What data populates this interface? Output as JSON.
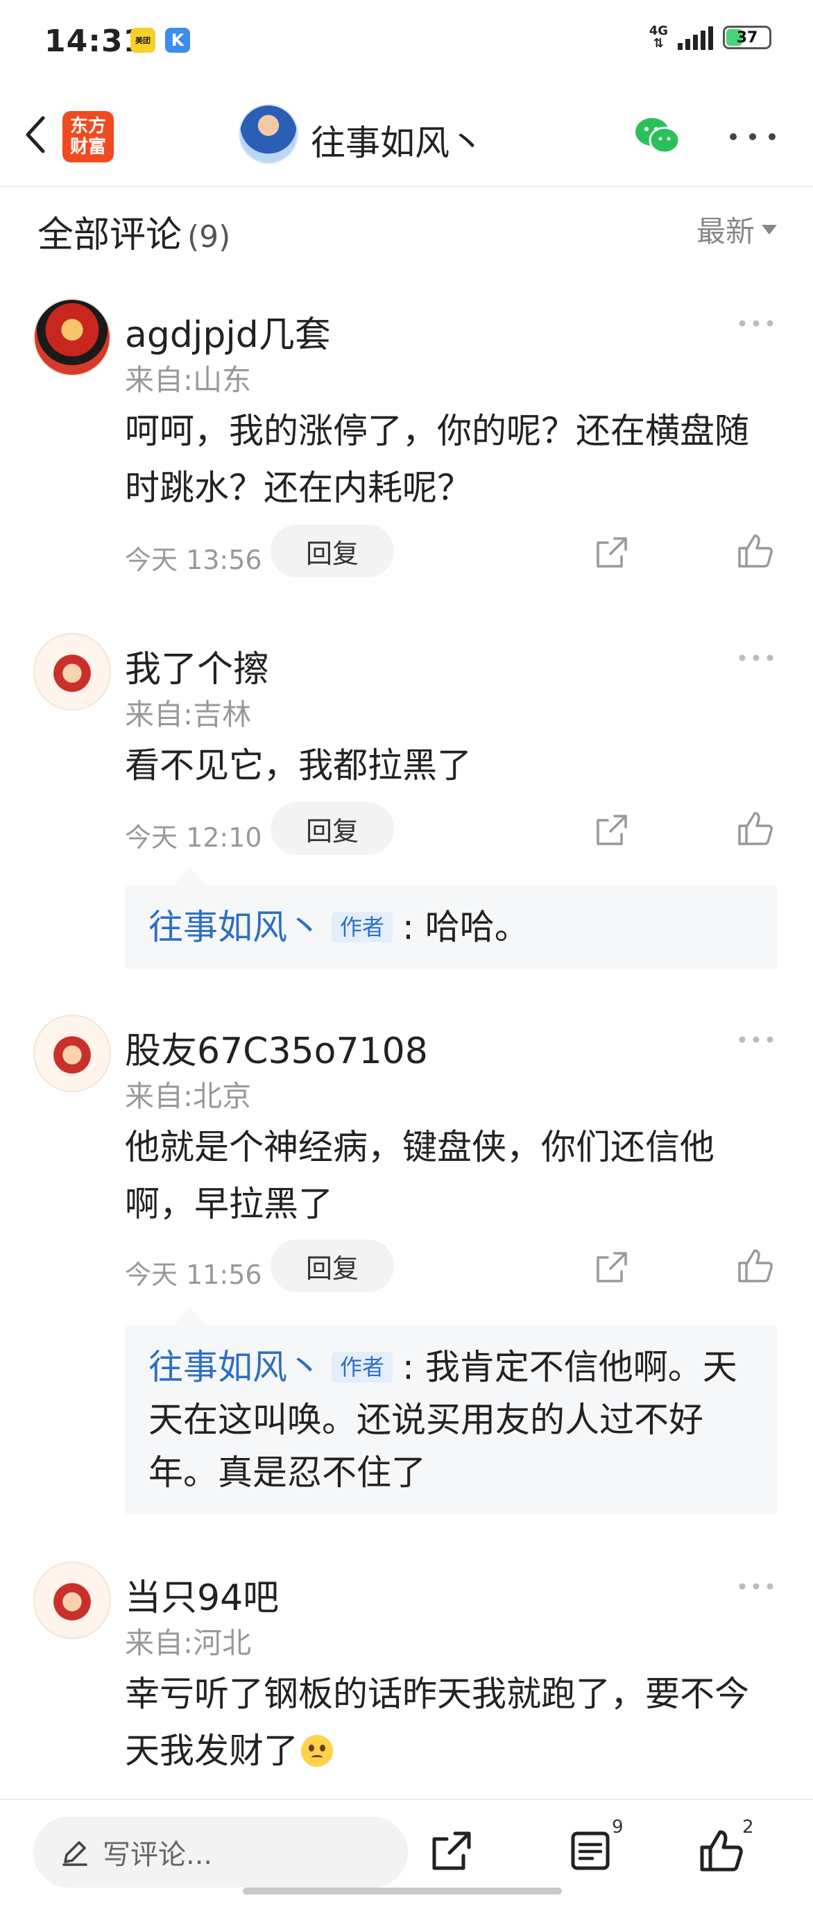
{
  "status_bar": {
    "time": "14:31",
    "app_icon_1": "美团",
    "app_icon_2": "K",
    "network": "4G",
    "battery": "37"
  },
  "nav": {
    "logo_line1": "东方",
    "logo_line2": "财富",
    "title": "往事如风丶"
  },
  "section": {
    "title": "全部评论",
    "count": "(9)",
    "sort": "最新"
  },
  "comments": [
    {
      "name": "agdjpjd几套",
      "location": "来自:山东",
      "text": "呵呵，我的涨停了，你的呢？还在横盘随时跳水？还在内耗呢？",
      "time": "今天 13:56",
      "reply_label": "回复"
    },
    {
      "name": "我了个擦",
      "location": "来自:吉林",
      "text": "看不见它，我都拉黑了",
      "time": "今天 12:10",
      "reply_label": "回复",
      "reply": {
        "author": "往事如风丶",
        "badge": "作者",
        "text": ": 哈哈。"
      }
    },
    {
      "name": "股友67C35o7108",
      "location": "来自:北京",
      "text": "他就是个神经病，键盘侠，你们还信他啊，早拉黑了",
      "time": "今天 11:56",
      "reply_label": "回复",
      "reply": {
        "author": "往事如风丶",
        "badge": "作者",
        "text": ": 我肯定不信他啊。天天在这叫唤。还说买用友的人过不好年。真是忍不住了"
      }
    },
    {
      "name": "当只94吧",
      "location": "来自:河北",
      "text": "幸亏听了钢板的话昨天我就跑了，要不今天我发财了"
    }
  ],
  "bottom_bar": {
    "placeholder": "写评论...",
    "comment_count": "9",
    "like_count": "2"
  }
}
